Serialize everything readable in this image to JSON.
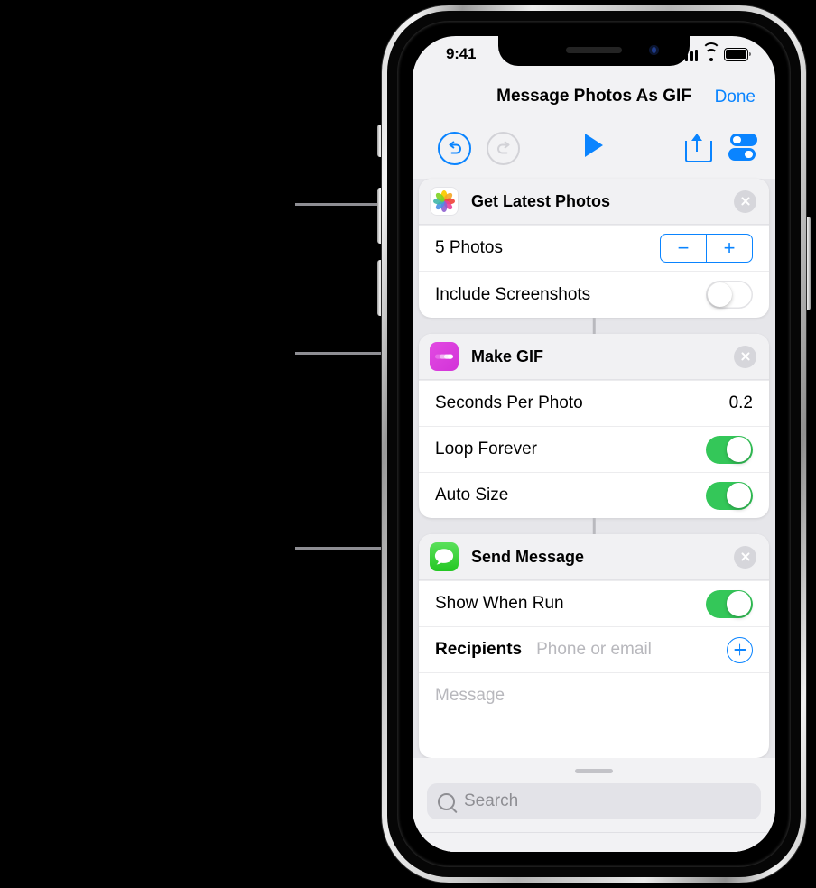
{
  "status_bar": {
    "time": "9:41",
    "cellular_icon": "cellular-bars-icon",
    "wifi_icon": "wifi-icon",
    "battery_icon": "battery-icon"
  },
  "nav": {
    "title": "Message Photos As GIF",
    "done_label": "Done"
  },
  "toolbar": {
    "undo_icon": "undo-icon",
    "redo_icon": "redo-icon",
    "play_icon": "play-icon",
    "share_icon": "share-icon",
    "settings_icon": "settings-toggles-icon"
  },
  "actions": [
    {
      "title": "Get Latest Photos",
      "icon": "photos-app-icon",
      "icon_color": "#ffffff",
      "close_icon": "close-icon",
      "rows": [
        {
          "label": "5 Photos",
          "control": "stepper",
          "minus_label": "−",
          "plus_label": "+"
        },
        {
          "label": "Include Screenshots",
          "control": "toggle",
          "state": "off"
        }
      ]
    },
    {
      "title": "Make GIF",
      "icon": "make-gif-icon",
      "icon_color": "#d936dd",
      "close_icon": "close-icon",
      "rows": [
        {
          "label": "Seconds Per Photo",
          "control": "value",
          "value": "0.2"
        },
        {
          "label": "Loop Forever",
          "control": "toggle",
          "state": "on"
        },
        {
          "label": "Auto Size",
          "control": "toggle",
          "state": "on"
        }
      ]
    },
    {
      "title": "Send Message",
      "icon": "messages-app-icon",
      "icon_color": "#3ac73a",
      "close_icon": "close-icon",
      "rows": [
        {
          "label": "Show When Run",
          "control": "toggle",
          "state": "on"
        },
        {
          "label": "Recipients",
          "control": "recipients",
          "placeholder": "Phone or email",
          "add_icon": "add-recipient-icon"
        }
      ],
      "message_placeholder": "Message"
    }
  ],
  "sheet": {
    "grabber": "sheet-grabber",
    "search_placeholder": "Search",
    "search_icon": "search-icon"
  },
  "colors": {
    "accent_blue": "#0a84ff",
    "toggle_green": "#34c759",
    "background": "#000000",
    "screen_bg": "#f2f2f4",
    "workflow_bg": "#e6e6ea"
  }
}
